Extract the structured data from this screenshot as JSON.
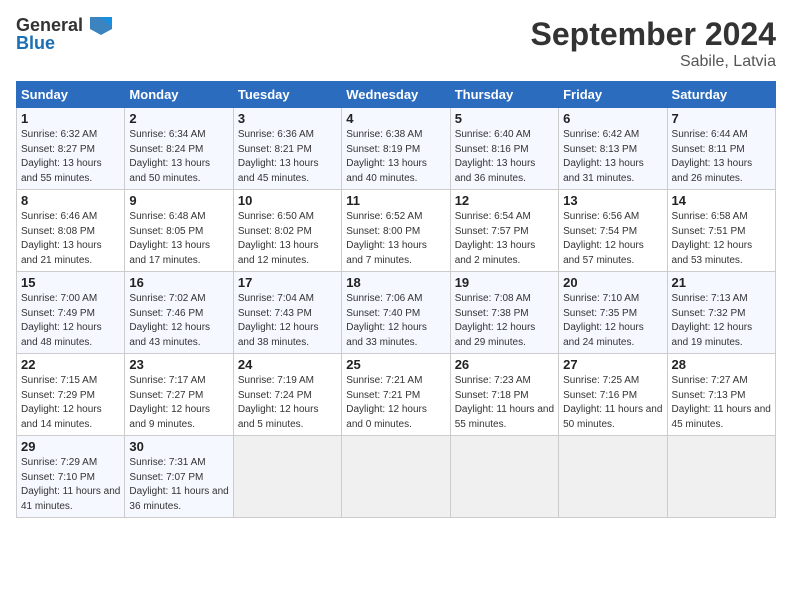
{
  "header": {
    "logo_line1": "General",
    "logo_line2": "Blue",
    "title": "September 2024",
    "subtitle": "Sabile, Latvia"
  },
  "weekdays": [
    "Sunday",
    "Monday",
    "Tuesday",
    "Wednesday",
    "Thursday",
    "Friday",
    "Saturday"
  ],
  "weeks": [
    [
      {
        "day": "1",
        "sunrise": "Sunrise: 6:32 AM",
        "sunset": "Sunset: 8:27 PM",
        "daylight": "Daylight: 13 hours and 55 minutes."
      },
      {
        "day": "2",
        "sunrise": "Sunrise: 6:34 AM",
        "sunset": "Sunset: 8:24 PM",
        "daylight": "Daylight: 13 hours and 50 minutes."
      },
      {
        "day": "3",
        "sunrise": "Sunrise: 6:36 AM",
        "sunset": "Sunset: 8:21 PM",
        "daylight": "Daylight: 13 hours and 45 minutes."
      },
      {
        "day": "4",
        "sunrise": "Sunrise: 6:38 AM",
        "sunset": "Sunset: 8:19 PM",
        "daylight": "Daylight: 13 hours and 40 minutes."
      },
      {
        "day": "5",
        "sunrise": "Sunrise: 6:40 AM",
        "sunset": "Sunset: 8:16 PM",
        "daylight": "Daylight: 13 hours and 36 minutes."
      },
      {
        "day": "6",
        "sunrise": "Sunrise: 6:42 AM",
        "sunset": "Sunset: 8:13 PM",
        "daylight": "Daylight: 13 hours and 31 minutes."
      },
      {
        "day": "7",
        "sunrise": "Sunrise: 6:44 AM",
        "sunset": "Sunset: 8:11 PM",
        "daylight": "Daylight: 13 hours and 26 minutes."
      }
    ],
    [
      {
        "day": "8",
        "sunrise": "Sunrise: 6:46 AM",
        "sunset": "Sunset: 8:08 PM",
        "daylight": "Daylight: 13 hours and 21 minutes."
      },
      {
        "day": "9",
        "sunrise": "Sunrise: 6:48 AM",
        "sunset": "Sunset: 8:05 PM",
        "daylight": "Daylight: 13 hours and 17 minutes."
      },
      {
        "day": "10",
        "sunrise": "Sunrise: 6:50 AM",
        "sunset": "Sunset: 8:02 PM",
        "daylight": "Daylight: 13 hours and 12 minutes."
      },
      {
        "day": "11",
        "sunrise": "Sunrise: 6:52 AM",
        "sunset": "Sunset: 8:00 PM",
        "daylight": "Daylight: 13 hours and 7 minutes."
      },
      {
        "day": "12",
        "sunrise": "Sunrise: 6:54 AM",
        "sunset": "Sunset: 7:57 PM",
        "daylight": "Daylight: 13 hours and 2 minutes."
      },
      {
        "day": "13",
        "sunrise": "Sunrise: 6:56 AM",
        "sunset": "Sunset: 7:54 PM",
        "daylight": "Daylight: 12 hours and 57 minutes."
      },
      {
        "day": "14",
        "sunrise": "Sunrise: 6:58 AM",
        "sunset": "Sunset: 7:51 PM",
        "daylight": "Daylight: 12 hours and 53 minutes."
      }
    ],
    [
      {
        "day": "15",
        "sunrise": "Sunrise: 7:00 AM",
        "sunset": "Sunset: 7:49 PM",
        "daylight": "Daylight: 12 hours and 48 minutes."
      },
      {
        "day": "16",
        "sunrise": "Sunrise: 7:02 AM",
        "sunset": "Sunset: 7:46 PM",
        "daylight": "Daylight: 12 hours and 43 minutes."
      },
      {
        "day": "17",
        "sunrise": "Sunrise: 7:04 AM",
        "sunset": "Sunset: 7:43 PM",
        "daylight": "Daylight: 12 hours and 38 minutes."
      },
      {
        "day": "18",
        "sunrise": "Sunrise: 7:06 AM",
        "sunset": "Sunset: 7:40 PM",
        "daylight": "Daylight: 12 hours and 33 minutes."
      },
      {
        "day": "19",
        "sunrise": "Sunrise: 7:08 AM",
        "sunset": "Sunset: 7:38 PM",
        "daylight": "Daylight: 12 hours and 29 minutes."
      },
      {
        "day": "20",
        "sunrise": "Sunrise: 7:10 AM",
        "sunset": "Sunset: 7:35 PM",
        "daylight": "Daylight: 12 hours and 24 minutes."
      },
      {
        "day": "21",
        "sunrise": "Sunrise: 7:13 AM",
        "sunset": "Sunset: 7:32 PM",
        "daylight": "Daylight: 12 hours and 19 minutes."
      }
    ],
    [
      {
        "day": "22",
        "sunrise": "Sunrise: 7:15 AM",
        "sunset": "Sunset: 7:29 PM",
        "daylight": "Daylight: 12 hours and 14 minutes."
      },
      {
        "day": "23",
        "sunrise": "Sunrise: 7:17 AM",
        "sunset": "Sunset: 7:27 PM",
        "daylight": "Daylight: 12 hours and 9 minutes."
      },
      {
        "day": "24",
        "sunrise": "Sunrise: 7:19 AM",
        "sunset": "Sunset: 7:24 PM",
        "daylight": "Daylight: 12 hours and 5 minutes."
      },
      {
        "day": "25",
        "sunrise": "Sunrise: 7:21 AM",
        "sunset": "Sunset: 7:21 PM",
        "daylight": "Daylight: 12 hours and 0 minutes."
      },
      {
        "day": "26",
        "sunrise": "Sunrise: 7:23 AM",
        "sunset": "Sunset: 7:18 PM",
        "daylight": "Daylight: 11 hours and 55 minutes."
      },
      {
        "day": "27",
        "sunrise": "Sunrise: 7:25 AM",
        "sunset": "Sunset: 7:16 PM",
        "daylight": "Daylight: 11 hours and 50 minutes."
      },
      {
        "day": "28",
        "sunrise": "Sunrise: 7:27 AM",
        "sunset": "Sunset: 7:13 PM",
        "daylight": "Daylight: 11 hours and 45 minutes."
      }
    ],
    [
      {
        "day": "29",
        "sunrise": "Sunrise: 7:29 AM",
        "sunset": "Sunset: 7:10 PM",
        "daylight": "Daylight: 11 hours and 41 minutes."
      },
      {
        "day": "30",
        "sunrise": "Sunrise: 7:31 AM",
        "sunset": "Sunset: 7:07 PM",
        "daylight": "Daylight: 11 hours and 36 minutes."
      },
      null,
      null,
      null,
      null,
      null
    ]
  ]
}
